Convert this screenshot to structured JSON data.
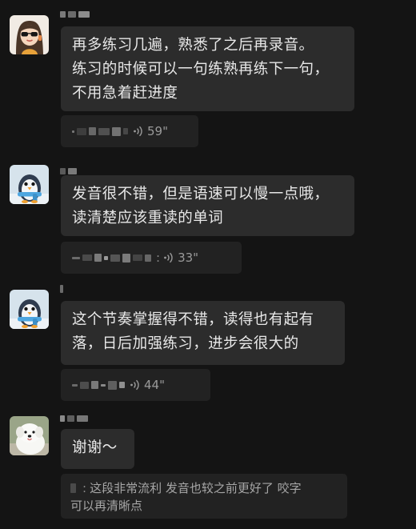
{
  "messages": [
    {
      "avatar": "girl-sunglasses-avatar",
      "text": "再多练习几遍，熟悉了之后再录音。\n练习的时候可以一句练熟再练下一句，\n不用急着赶进度",
      "voice_duration": "59\""
    },
    {
      "avatar": "penguin-avatar",
      "text": "发音很不错，但是语速可以慢一点哦，\n读清楚应该重读的单词",
      "voice_duration": "33\""
    },
    {
      "avatar": "penguin-avatar",
      "text": "这个节奏掌握得不错，读得也有起有\n落，日后加强练习，进步会很大的",
      "voice_duration": "44\""
    },
    {
      "avatar": "white-dog-avatar",
      "text": "谢谢～",
      "quoted_text": "这段非常流利 发音也较之前更好了 咬字\n可以再清晰点"
    }
  ],
  "voice_separator": ":",
  "colors": {
    "background": "#141414",
    "bubble": "#2c2c2c",
    "quote": "#222222"
  }
}
